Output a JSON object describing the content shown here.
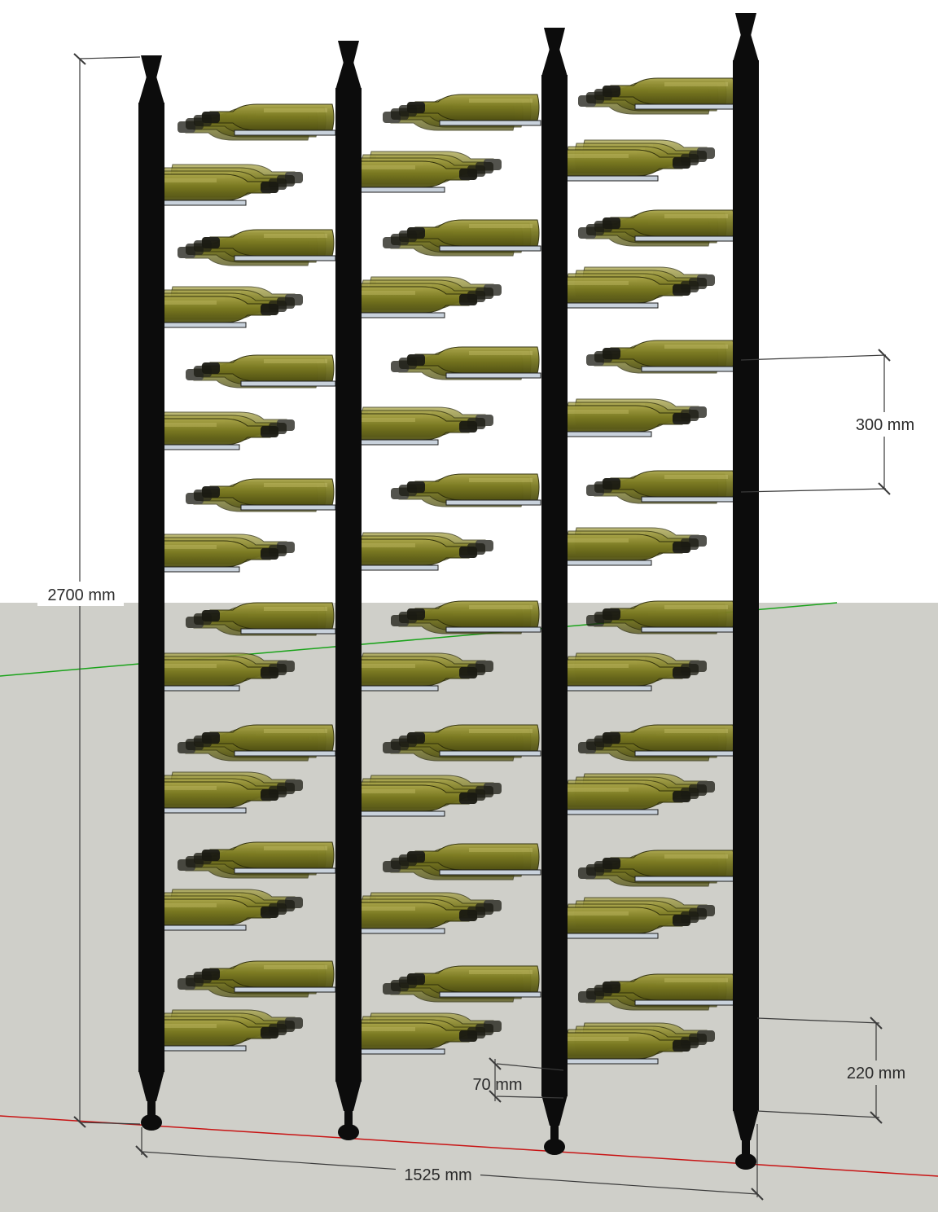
{
  "colors": {
    "sky": "#ffffff",
    "ground": "#cfcfc9",
    "post": "#0c0c0c",
    "bottle_glass": "#7b7a22",
    "bottle_highlight": "#b9b45c",
    "bottle_neck": "#1a1a12",
    "bottle_rod": "#c9d2dc",
    "dimension_line": "#3a3a3a",
    "axis_green": "#1aa31a",
    "axis_red": "#c81414"
  },
  "dimensions": {
    "total_height": "2700 mm",
    "row_spacing": "300 mm",
    "bottom_clearance": "220 mm",
    "bottle_offset": "70 mm",
    "total_width": "1525 mm"
  }
}
